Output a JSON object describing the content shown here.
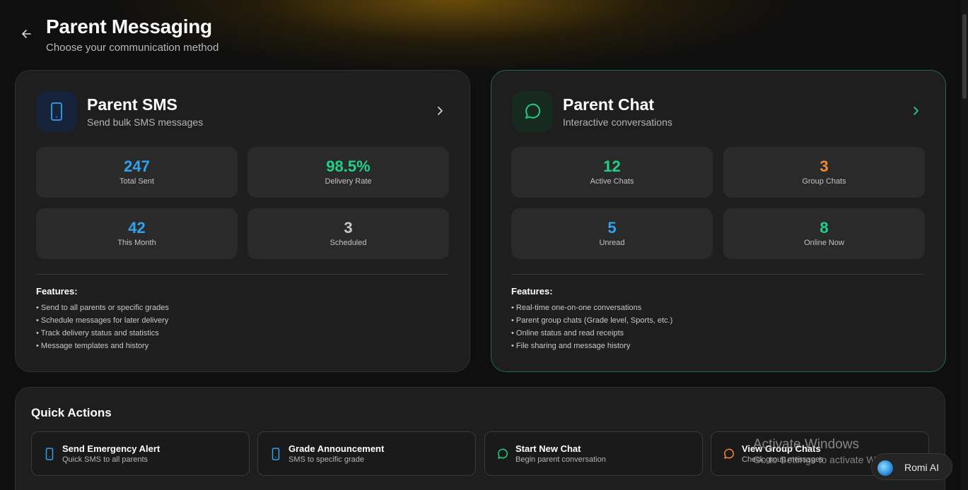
{
  "colors": {
    "background": "#0f0f0f",
    "card": "#1e1e1e",
    "stat_box": "#2a2a2a",
    "blue": "#2fa4ec",
    "green": "#1ed28a",
    "orange": "#f08b32",
    "gray_value": "#c9c9c9"
  },
  "header": {
    "title": "Parent Messaging",
    "subtitle": "Choose your communication method",
    "back_icon": "arrow-left-icon"
  },
  "sms_card": {
    "icon": "smartphone-icon",
    "title": "Parent SMS",
    "subtitle": "Send bulk SMS messages",
    "stats": [
      {
        "value": "247",
        "label": "Total Sent"
      },
      {
        "value": "98.5%",
        "label": "Delivery Rate"
      },
      {
        "value": "42",
        "label": "This Month"
      },
      {
        "value": "3",
        "label": "Scheduled"
      }
    ],
    "features_title": "Features:",
    "features": [
      "• Send to all parents or specific grades",
      "• Schedule messages for later delivery",
      "• Track delivery status and statistics",
      "• Message templates and history"
    ]
  },
  "chat_card": {
    "icon": "message-circle-icon",
    "title": "Parent Chat",
    "subtitle": "Interactive conversations",
    "stats": [
      {
        "value": "12",
        "label": "Active Chats"
      },
      {
        "value": "3",
        "label": "Group Chats"
      },
      {
        "value": "5",
        "label": "Unread"
      },
      {
        "value": "8",
        "label": "Online Now"
      }
    ],
    "features_title": "Features:",
    "features": [
      "• Real-time one-on-one conversations",
      "• Parent group chats (Grade level, Sports, etc.)",
      "• Online status and read receipts",
      "• File sharing and message history"
    ]
  },
  "quick_actions": {
    "title": "Quick Actions",
    "items": [
      {
        "title": "Send Emergency Alert",
        "subtitle": "Quick SMS to all parents",
        "icon": "smartphone-icon"
      },
      {
        "title": "Grade Announcement",
        "subtitle": "SMS to specific grade",
        "icon": "smartphone-icon"
      },
      {
        "title": "Start New Chat",
        "subtitle": "Begin parent conversation",
        "icon": "message-circle-icon"
      },
      {
        "title": "View Group Chats",
        "subtitle": "Check group messages",
        "icon": "message-circle-icon"
      }
    ]
  },
  "watermark": {
    "line1": "Activate Windows",
    "line2": "Go to Settings to activate Windows."
  },
  "assistant": {
    "label": "Romi AI"
  }
}
